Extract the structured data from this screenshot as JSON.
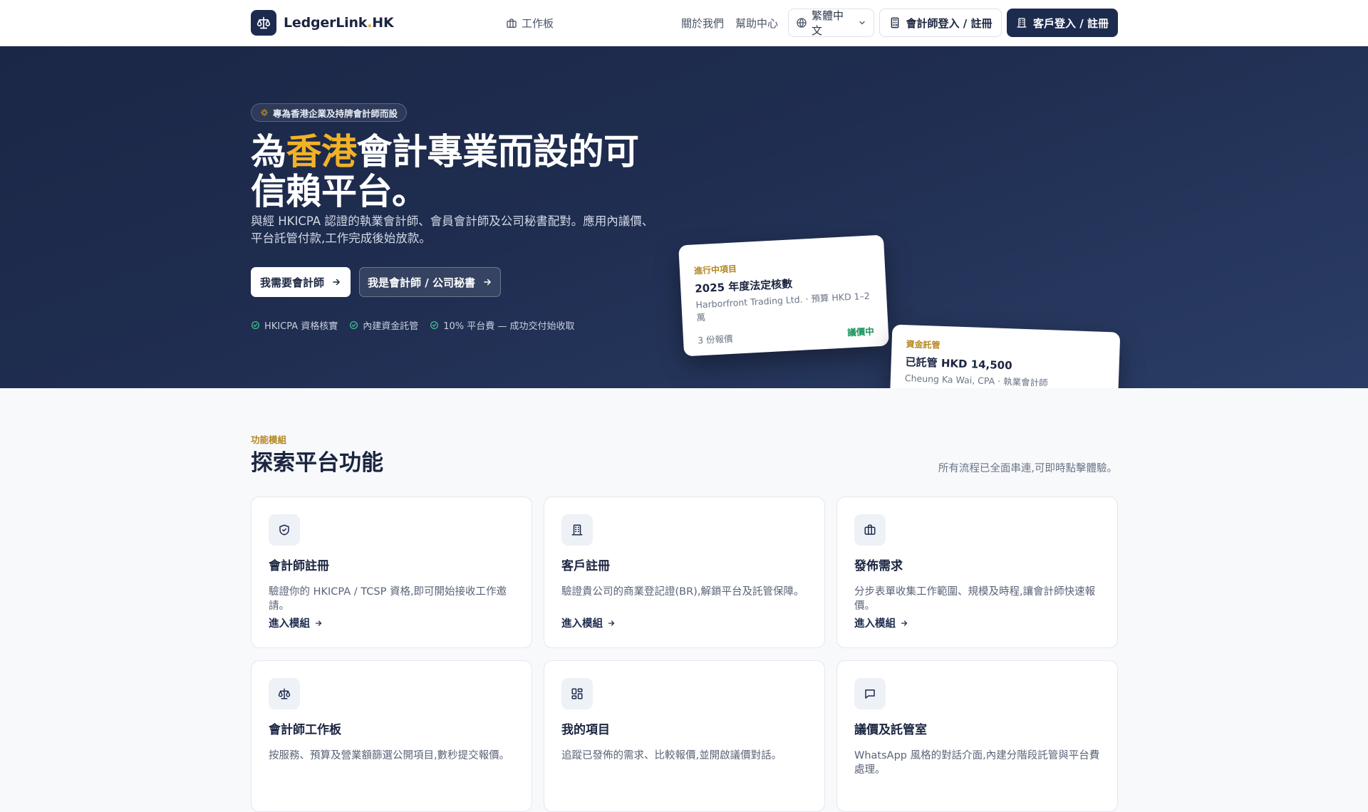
{
  "header": {
    "brand": {
      "name_main": "LedgerLink",
      "name_dot": ".",
      "name_tld": "HK",
      "logo_icon": "scale-icon"
    },
    "nav_board": {
      "label": "工作板",
      "icon": "briefcase-icon"
    },
    "nav_about": "關於我們",
    "nav_help": "幫助中心",
    "language": {
      "selected": "繁體中文",
      "icon": "globe-icon"
    },
    "accountant_login": {
      "label": "會計師登入 / 註冊",
      "icon": "calculator-icon"
    },
    "client_login": {
      "label": "客戶登入 / 註冊",
      "icon": "building-icon"
    }
  },
  "hero": {
    "pill": "專為香港企業及持牌會計師而設",
    "title_before": "為",
    "title_highlight": "香港",
    "title_after": "會計專業而設的可信賴平台。",
    "subtitle": "與經 HKICPA 認證的執業會計師、會員會計師及公司秘書配對。應用內議價、平台託管付款,工作完成後始放款。",
    "cta_primary": "我需要會計師",
    "cta_secondary": "我是會計師 / 公司秘書",
    "checks": [
      "HKICPA 資格核實",
      "內建資金託管",
      "10% 平台費 — 成功交付始收取"
    ],
    "card_project": {
      "kicker": "進行中項目",
      "title": "2025 年度法定核數",
      "meta": "Harborfront Trading Ltd. · 預算 HKD 1–2 萬",
      "quotes": "3 份報價",
      "status": "議價中"
    },
    "card_escrow": {
      "kicker": "資金託管",
      "title": "已託管 HKD 14,500",
      "meta": "Cheung Ka Wai, CPA · 執業會計師"
    }
  },
  "features": {
    "kicker": "功能模組",
    "title": "探索平台功能",
    "note": "所有流程已全面串連,可即時點擊體驗。",
    "link_label": "進入模組",
    "items": [
      {
        "title": "會計師註冊",
        "desc": "驗證你的 HKICPA / TCSP 資格,即可開始接收工作邀請。",
        "icon": "shield-check-icon"
      },
      {
        "title": "客戶註冊",
        "desc": "驗證貴公司的商業登記證(BR),解鎖平台及託管保障。",
        "icon": "building-icon"
      },
      {
        "title": "發佈需求",
        "desc": "分步表單收集工作範圍、規模及時程,讓會計師快速報價。",
        "icon": "briefcase-icon"
      },
      {
        "title": "會計師工作板",
        "desc": "按服務、預算及營業額篩選公開項目,數秒提交報價。",
        "icon": "scale-icon"
      },
      {
        "title": "我的項目",
        "desc": "追蹤已發佈的需求、比較報價,並開啟議價對話。",
        "icon": "grid-icon"
      },
      {
        "title": "議價及託管室",
        "desc": "WhatsApp 風格的對話介面,內建分階段託管與平台費處理。",
        "icon": "chat-icon"
      }
    ]
  },
  "colors": {
    "navy": "#1d2b4f",
    "accent": "#f2b227",
    "gold_text": "#b5861f",
    "success": "#18925b"
  }
}
